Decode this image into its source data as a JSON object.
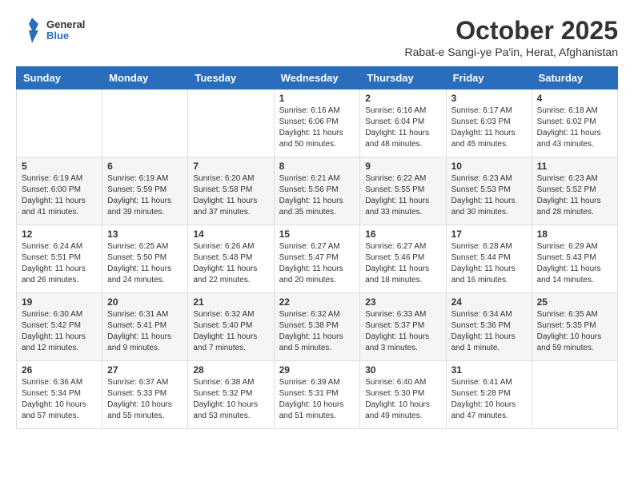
{
  "header": {
    "logo_general": "General",
    "logo_blue": "Blue",
    "month": "October 2025",
    "location": "Rabat-e Sangi-ye Pa'in, Herat, Afghanistan"
  },
  "weekdays": [
    "Sunday",
    "Monday",
    "Tuesday",
    "Wednesday",
    "Thursday",
    "Friday",
    "Saturday"
  ],
  "weeks": [
    [
      {
        "day": "",
        "sunrise": "",
        "sunset": "",
        "daylight": ""
      },
      {
        "day": "",
        "sunrise": "",
        "sunset": "",
        "daylight": ""
      },
      {
        "day": "",
        "sunrise": "",
        "sunset": "",
        "daylight": ""
      },
      {
        "day": "1",
        "sunrise": "Sunrise: 6:16 AM",
        "sunset": "Sunset: 6:06 PM",
        "daylight": "Daylight: 11 hours and 50 minutes."
      },
      {
        "day": "2",
        "sunrise": "Sunrise: 6:16 AM",
        "sunset": "Sunset: 6:04 PM",
        "daylight": "Daylight: 11 hours and 48 minutes."
      },
      {
        "day": "3",
        "sunrise": "Sunrise: 6:17 AM",
        "sunset": "Sunset: 6:03 PM",
        "daylight": "Daylight: 11 hours and 45 minutes."
      },
      {
        "day": "4",
        "sunrise": "Sunrise: 6:18 AM",
        "sunset": "Sunset: 6:02 PM",
        "daylight": "Daylight: 11 hours and 43 minutes."
      }
    ],
    [
      {
        "day": "5",
        "sunrise": "Sunrise: 6:19 AM",
        "sunset": "Sunset: 6:00 PM",
        "daylight": "Daylight: 11 hours and 41 minutes."
      },
      {
        "day": "6",
        "sunrise": "Sunrise: 6:19 AM",
        "sunset": "Sunset: 5:59 PM",
        "daylight": "Daylight: 11 hours and 39 minutes."
      },
      {
        "day": "7",
        "sunrise": "Sunrise: 6:20 AM",
        "sunset": "Sunset: 5:58 PM",
        "daylight": "Daylight: 11 hours and 37 minutes."
      },
      {
        "day": "8",
        "sunrise": "Sunrise: 6:21 AM",
        "sunset": "Sunset: 5:56 PM",
        "daylight": "Daylight: 11 hours and 35 minutes."
      },
      {
        "day": "9",
        "sunrise": "Sunrise: 6:22 AM",
        "sunset": "Sunset: 5:55 PM",
        "daylight": "Daylight: 11 hours and 33 minutes."
      },
      {
        "day": "10",
        "sunrise": "Sunrise: 6:23 AM",
        "sunset": "Sunset: 5:53 PM",
        "daylight": "Daylight: 11 hours and 30 minutes."
      },
      {
        "day": "11",
        "sunrise": "Sunrise: 6:23 AM",
        "sunset": "Sunset: 5:52 PM",
        "daylight": "Daylight: 11 hours and 28 minutes."
      }
    ],
    [
      {
        "day": "12",
        "sunrise": "Sunrise: 6:24 AM",
        "sunset": "Sunset: 5:51 PM",
        "daylight": "Daylight: 11 hours and 26 minutes."
      },
      {
        "day": "13",
        "sunrise": "Sunrise: 6:25 AM",
        "sunset": "Sunset: 5:50 PM",
        "daylight": "Daylight: 11 hours and 24 minutes."
      },
      {
        "day": "14",
        "sunrise": "Sunrise: 6:26 AM",
        "sunset": "Sunset: 5:48 PM",
        "daylight": "Daylight: 11 hours and 22 minutes."
      },
      {
        "day": "15",
        "sunrise": "Sunrise: 6:27 AM",
        "sunset": "Sunset: 5:47 PM",
        "daylight": "Daylight: 11 hours and 20 minutes."
      },
      {
        "day": "16",
        "sunrise": "Sunrise: 6:27 AM",
        "sunset": "Sunset: 5:46 PM",
        "daylight": "Daylight: 11 hours and 18 minutes."
      },
      {
        "day": "17",
        "sunrise": "Sunrise: 6:28 AM",
        "sunset": "Sunset: 5:44 PM",
        "daylight": "Daylight: 11 hours and 16 minutes."
      },
      {
        "day": "18",
        "sunrise": "Sunrise: 6:29 AM",
        "sunset": "Sunset: 5:43 PM",
        "daylight": "Daylight: 11 hours and 14 minutes."
      }
    ],
    [
      {
        "day": "19",
        "sunrise": "Sunrise: 6:30 AM",
        "sunset": "Sunset: 5:42 PM",
        "daylight": "Daylight: 11 hours and 12 minutes."
      },
      {
        "day": "20",
        "sunrise": "Sunrise: 6:31 AM",
        "sunset": "Sunset: 5:41 PM",
        "daylight": "Daylight: 11 hours and 9 minutes."
      },
      {
        "day": "21",
        "sunrise": "Sunrise: 6:32 AM",
        "sunset": "Sunset: 5:40 PM",
        "daylight": "Daylight: 11 hours and 7 minutes."
      },
      {
        "day": "22",
        "sunrise": "Sunrise: 6:32 AM",
        "sunset": "Sunset: 5:38 PM",
        "daylight": "Daylight: 11 hours and 5 minutes."
      },
      {
        "day": "23",
        "sunrise": "Sunrise: 6:33 AM",
        "sunset": "Sunset: 5:37 PM",
        "daylight": "Daylight: 11 hours and 3 minutes."
      },
      {
        "day": "24",
        "sunrise": "Sunrise: 6:34 AM",
        "sunset": "Sunset: 5:36 PM",
        "daylight": "Daylight: 11 hours and 1 minute."
      },
      {
        "day": "25",
        "sunrise": "Sunrise: 6:35 AM",
        "sunset": "Sunset: 5:35 PM",
        "daylight": "Daylight: 10 hours and 59 minutes."
      }
    ],
    [
      {
        "day": "26",
        "sunrise": "Sunrise: 6:36 AM",
        "sunset": "Sunset: 5:34 PM",
        "daylight": "Daylight: 10 hours and 57 minutes."
      },
      {
        "day": "27",
        "sunrise": "Sunrise: 6:37 AM",
        "sunset": "Sunset: 5:33 PM",
        "daylight": "Daylight: 10 hours and 55 minutes."
      },
      {
        "day": "28",
        "sunrise": "Sunrise: 6:38 AM",
        "sunset": "Sunset: 5:32 PM",
        "daylight": "Daylight: 10 hours and 53 minutes."
      },
      {
        "day": "29",
        "sunrise": "Sunrise: 6:39 AM",
        "sunset": "Sunset: 5:31 PM",
        "daylight": "Daylight: 10 hours and 51 minutes."
      },
      {
        "day": "30",
        "sunrise": "Sunrise: 6:40 AM",
        "sunset": "Sunset: 5:30 PM",
        "daylight": "Daylight: 10 hours and 49 minutes."
      },
      {
        "day": "31",
        "sunrise": "Sunrise: 6:41 AM",
        "sunset": "Sunset: 5:28 PM",
        "daylight": "Daylight: 10 hours and 47 minutes."
      },
      {
        "day": "",
        "sunrise": "",
        "sunset": "",
        "daylight": ""
      }
    ]
  ]
}
